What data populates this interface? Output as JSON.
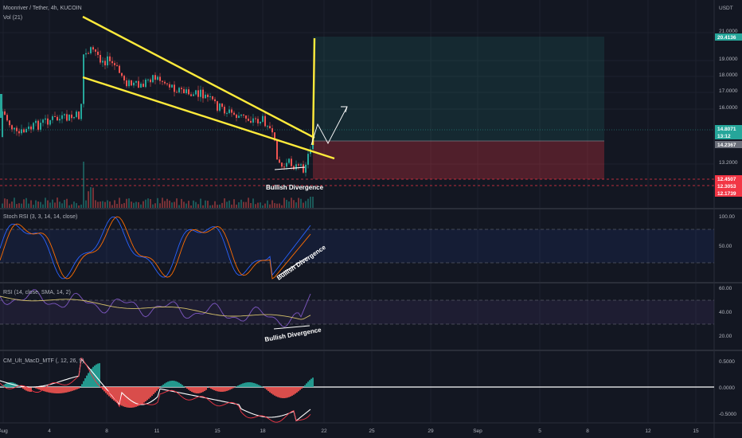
{
  "header": {
    "symbol": "Moonriver / Tether, 4h, KUCOIN",
    "volume_label": "Vol (21)"
  },
  "indicators": {
    "stoch_label": "Stoch RSI (3, 3, 14, 14, close)",
    "rsi_label": "RSI (14, close, SMA, 14, 2)",
    "macd_label": "CM_Ult_MacD_MTF (, 12, 26, 9)"
  },
  "annotations": {
    "price": "Bullish Divergence",
    "stoch": "Bullish Divergence",
    "rsi": "Bullish Divergence"
  },
  "price_axis": {
    "unit": "USDT",
    "ticks": [
      "21.0000",
      "19.0000",
      "18.0000",
      "17.0000",
      "16.0000",
      "13.2000"
    ],
    "badges": [
      {
        "text": "20.4136",
        "color": "#26a69a"
      },
      {
        "text": "14.8071",
        "color": "#26a69a"
      },
      {
        "text": "13:12",
        "color": "#26a69a"
      },
      {
        "text": "14.2367",
        "color": "#6b6f7a"
      },
      {
        "text": "12.4507",
        "color": "#f23645"
      },
      {
        "text": "12.3053",
        "color": "#f23645"
      },
      {
        "text": "12.1739",
        "color": "#f23645"
      }
    ]
  },
  "stoch_axis": {
    "ticks": [
      "100.00",
      "50.00"
    ]
  },
  "rsi_axis": {
    "ticks": [
      "60.00",
      "40.00",
      "20.00"
    ]
  },
  "macd_axis": {
    "ticks": [
      "0.5000",
      "0.0000",
      "-0.5000"
    ]
  },
  "time_axis": {
    "ticks": [
      "Aug",
      "4",
      "8",
      "11",
      "15",
      "18",
      "22",
      "25",
      "29",
      "Sep",
      "5",
      "8",
      "12",
      "15"
    ]
  },
  "colors": {
    "bull": "#26a69a",
    "bear": "#ef5350",
    "wedge": "#ffeb3b",
    "background": "#131722"
  },
  "chart_data": {
    "type": "candlestick",
    "pattern": "falling wedge",
    "indicators": [
      "Vol (21)",
      "Stoch RSI",
      "RSI",
      "MACD"
    ],
    "position": {
      "target": 20.4136,
      "entry": 14.2367,
      "stop_levels": [
        12.4507,
        12.3053,
        12.1739
      ],
      "last_price": 14.8071
    }
  }
}
